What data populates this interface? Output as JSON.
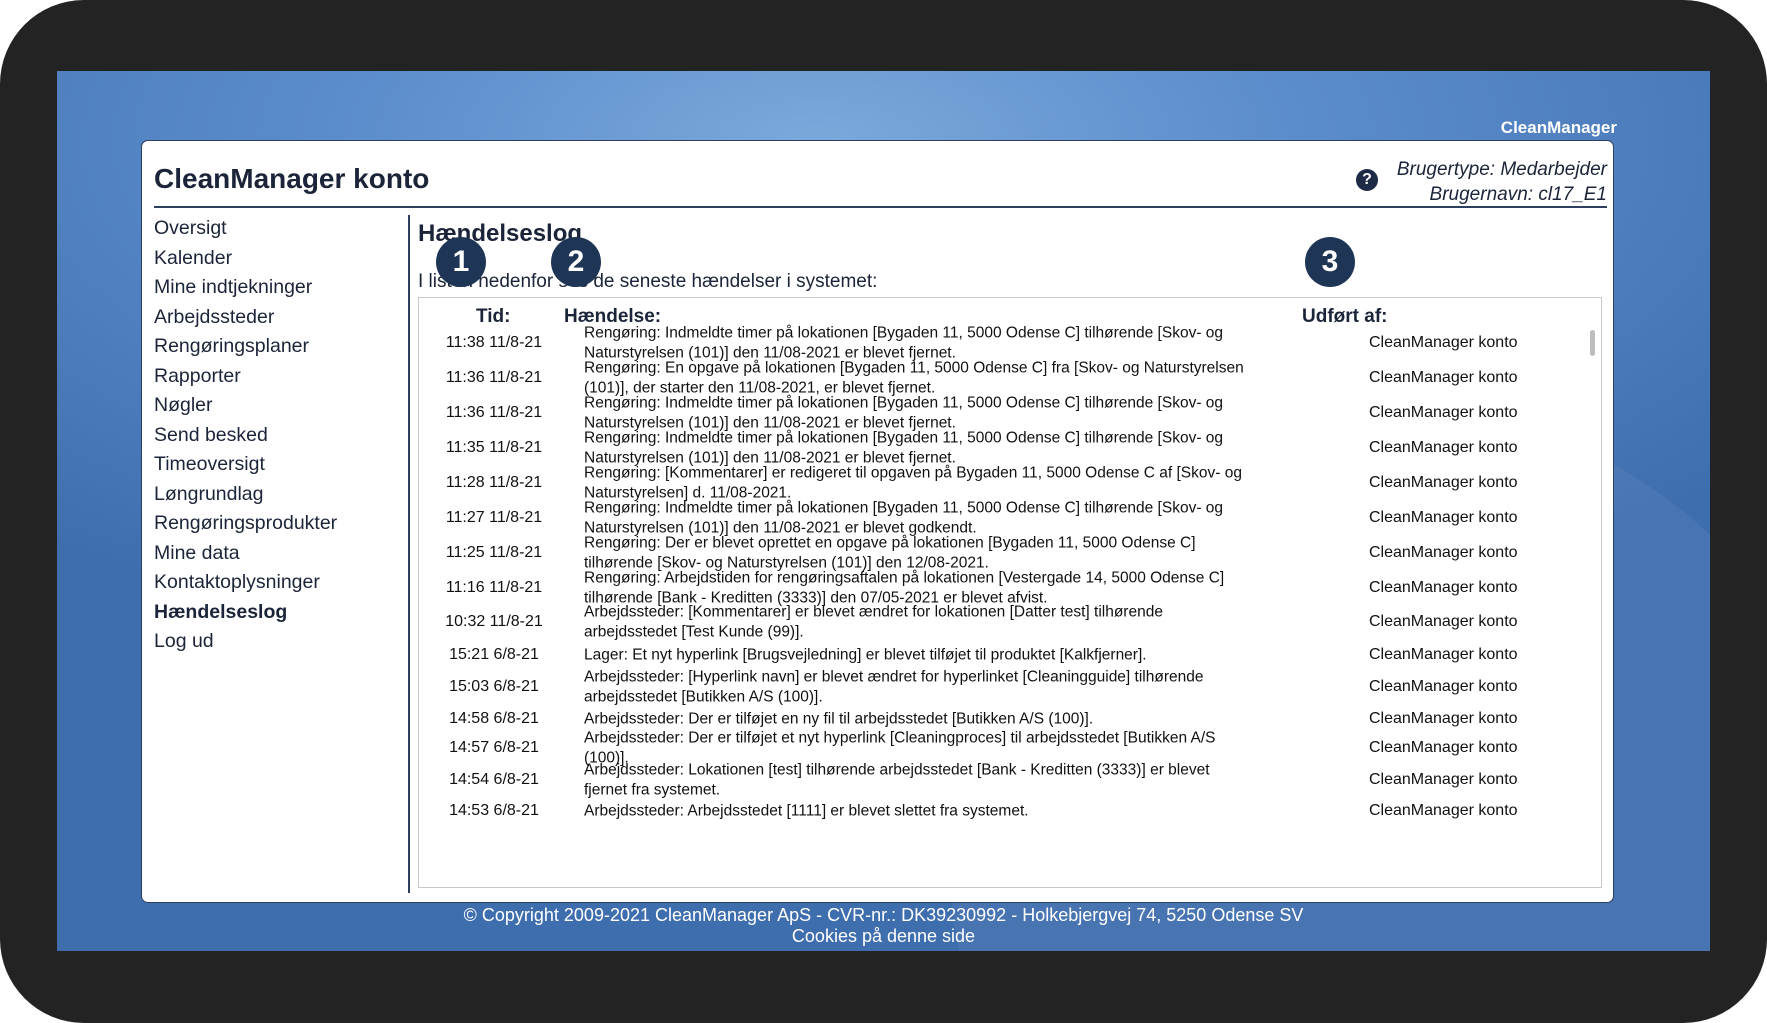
{
  "brand": "CleanManager",
  "card": {
    "title": "CleanManager konto",
    "user_type": "Brugertype: Medarbejder",
    "user_name": "Brugernavn: cl17_E1"
  },
  "sidebar": {
    "items": [
      {
        "label": "Oversigt"
      },
      {
        "label": "Kalender"
      },
      {
        "label": "Mine indtjekninger"
      },
      {
        "label": "Arbejdssteder"
      },
      {
        "label": "Rengøringsplaner"
      },
      {
        "label": "Rapporter"
      },
      {
        "label": "Nøgler"
      },
      {
        "label": "Send besked"
      },
      {
        "label": "Timeoversigt"
      },
      {
        "label": "Løngrundlag"
      },
      {
        "label": "Rengøringsprodukter"
      },
      {
        "label": "Mine data"
      },
      {
        "label": "Kontaktoplysninger"
      },
      {
        "label": "Hændelseslog"
      },
      {
        "label": "Log ud"
      }
    ],
    "active": "Hændelseslog"
  },
  "main": {
    "title": "Hændelseslog",
    "intro": "I listen nedenfor ses de seneste hændelser i systemet:",
    "columns": {
      "time": "Tid:",
      "event": "Hændelse:",
      "by": "Udført af:"
    },
    "rows": [
      {
        "time": "11:38 11/8-21",
        "event": "Rengøring: Indmeldte timer på lokationen [Bygaden 11, 5000 Odense C] tilhørende [Skov- og Naturstyrelsen (101)] den 11/08-2021 er blevet fjernet.",
        "by": "CleanManager konto"
      },
      {
        "time": "11:36 11/8-21",
        "event": "Rengøring: En opgave på lokationen [Bygaden 11, 5000 Odense C] fra [Skov- og Naturstyrelsen (101)], der starter den 11/08-2021, er blevet fjernet.",
        "by": "CleanManager konto"
      },
      {
        "time": "11:36 11/8-21",
        "event": "Rengøring: Indmeldte timer på lokationen [Bygaden 11, 5000 Odense C] tilhørende [Skov- og Naturstyrelsen (101)] den 11/08-2021 er blevet fjernet.",
        "by": "CleanManager konto"
      },
      {
        "time": "11:35 11/8-21",
        "event": "Rengøring: Indmeldte timer på lokationen [Bygaden 11, 5000 Odense C] tilhørende [Skov- og Naturstyrelsen (101)] den 11/08-2021 er blevet fjernet.",
        "by": "CleanManager konto"
      },
      {
        "time": "11:28 11/8-21",
        "event": "Rengøring: [Kommentarer] er redigeret til opgaven på Bygaden 11, 5000 Odense C af [Skov- og Naturstyrelsen] d. 11/08-2021.",
        "by": "CleanManager konto"
      },
      {
        "time": "11:27 11/8-21",
        "event": "Rengøring: Indmeldte timer på lokationen [Bygaden 11, 5000 Odense C] tilhørende [Skov- og Naturstyrelsen (101)] den 11/08-2021 er blevet godkendt.",
        "by": "CleanManager konto"
      },
      {
        "time": "11:25 11/8-21",
        "event": "Rengøring: Der er blevet oprettet en opgave på lokationen [Bygaden 11, 5000 Odense C] tilhørende [Skov- og Naturstyrelsen (101)] den 12/08-2021.",
        "by": "CleanManager konto"
      },
      {
        "time": "11:16 11/8-21",
        "event": "Rengøring: Arbejdstiden for rengøringsaftalen på lokationen [Vestergade 14, 5000 Odense C] tilhørende [Bank - Kreditten (3333)] den 07/05-2021 er blevet afvist.",
        "by": "CleanManager konto"
      },
      {
        "time": "10:32 11/8-21",
        "event": "Arbejdssteder: [Kommentarer] er blevet ændret for lokationen [Datter test] tilhørende arbejdsstedet [Test Kunde (99)].",
        "by": "CleanManager konto"
      },
      {
        "time": "15:21 6/8-21",
        "event": "Lager: Et nyt hyperlink [Brugsvejledning] er blevet tilføjet til produktet [Kalkfjerner].",
        "by": "CleanManager konto"
      },
      {
        "time": "15:03 6/8-21",
        "event": "Arbejdssteder: [Hyperlink navn] er blevet ændret for hyperlinket [Cleaningguide] tilhørende arbejdsstedet [Butikken A/S (100)].",
        "by": "CleanManager konto"
      },
      {
        "time": "14:58 6/8-21",
        "event": "Arbejdssteder: Der er tilføjet en ny fil til arbejdsstedet [Butikken A/S (100)].",
        "by": "CleanManager konto"
      },
      {
        "time": "14:57 6/8-21",
        "event": "Arbejdssteder: Der er tilføjet et nyt hyperlink [Cleaningproces] til arbejdsstedet [Butikken A/S (100)].",
        "by": "CleanManager konto"
      },
      {
        "time": "14:54 6/8-21",
        "event": "Arbejdssteder: Lokationen [test] tilhørende arbejdsstedet [Bank - Kreditten (3333)] er blevet fjernet fra systemet.",
        "by": "CleanManager konto"
      },
      {
        "time": "14:53 6/8-21",
        "event": "Arbejdssteder: Arbejdsstedet [1111] er blevet slettet fra systemet.",
        "by": "CleanManager konto"
      }
    ]
  },
  "markers": [
    "1",
    "2",
    "3"
  ],
  "footer": {
    "copyright": "© Copyright 2009-2021 CleanManager ApS - CVR-nr.: DK39230992 - Holkebjergvej 74, 5250 Odense SV",
    "cookies": "Cookies på denne side"
  }
}
